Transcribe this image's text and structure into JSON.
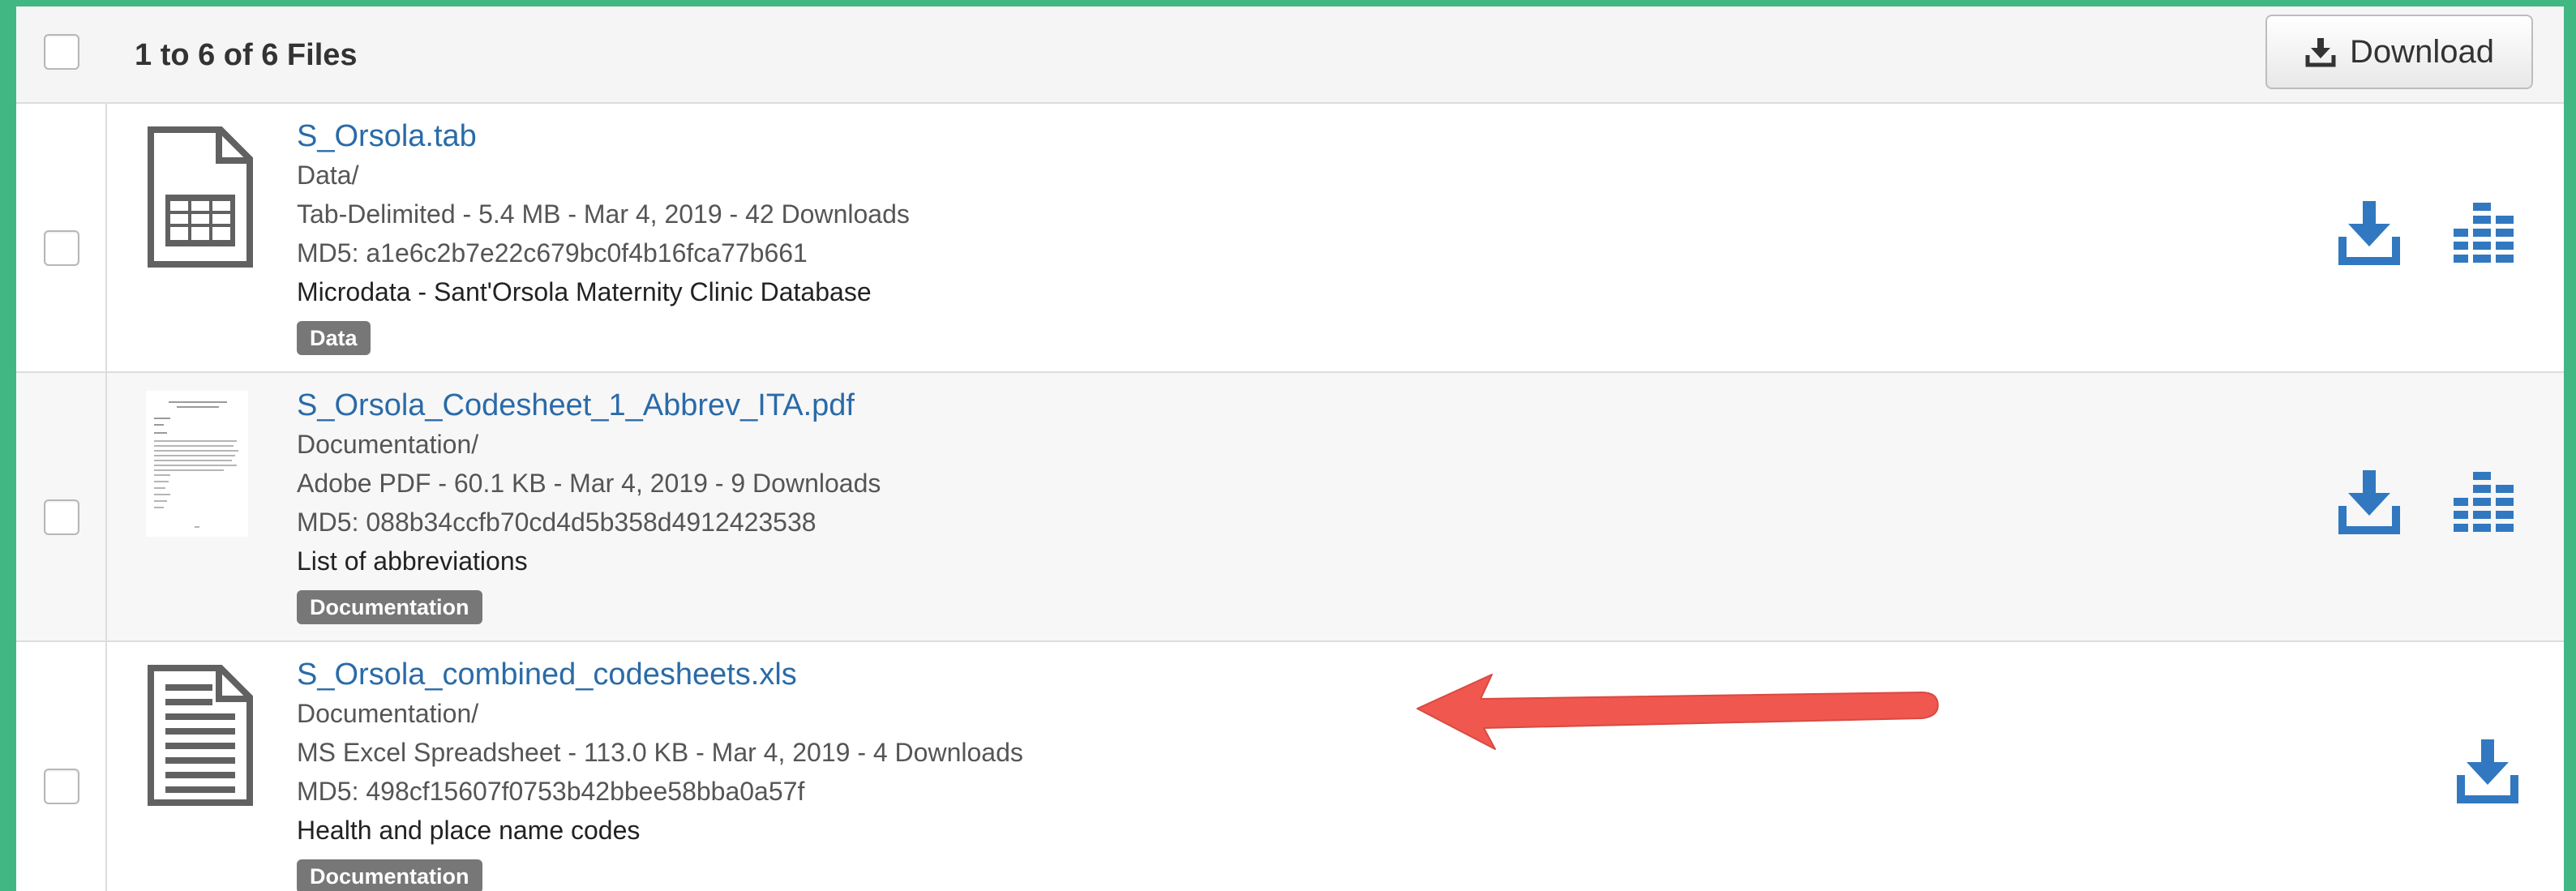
{
  "header": {
    "title": "1 to 6 of 6 Files",
    "download_label": "Download"
  },
  "files": [
    {
      "name": "S_Orsola.tab",
      "folder": "Data/",
      "details": "Tab-Delimited - 5.4 MB - Mar 4, 2019 - 42 Downloads",
      "md5": "MD5: a1e6c2b7e22c679bc0f4b16fca77b661",
      "description": "Microdata - Sant'Orsola Maternity Clinic Database",
      "tag": "Data",
      "thumbnail_icon": "tabular-file-icon",
      "actions": [
        "download-icon",
        "explore-icon"
      ]
    },
    {
      "name": "S_Orsola_Codesheet_1_Abbrev_ITA.pdf",
      "folder": "Documentation/",
      "details": "Adobe PDF - 60.1 KB - Mar 4, 2019 - 9 Downloads",
      "md5": "MD5: 088b34ccfb70cd4d5b358d4912423538",
      "description": "List of abbreviations",
      "tag": "Documentation",
      "thumbnail_icon": "pdf-thumbnail",
      "actions": [
        "download-icon",
        "explore-icon"
      ]
    },
    {
      "name": "S_Orsola_combined_codesheets.xls",
      "folder": "Documentation/",
      "details": "MS Excel Spreadsheet - 113.0 KB - Mar 4, 2019 - 4 Downloads",
      "md5": "MD5: 498cf15607f0753b42bbee58bba0a57f",
      "description": "Health and place name codes",
      "tag": "Documentation",
      "thumbnail_icon": "document-file-icon",
      "actions": [
        "download-icon"
      ]
    }
  ],
  "colors": {
    "frame_border": "#41b883",
    "link": "#2a6ba8",
    "action_icon": "#3178c0",
    "tag_bg": "#777777",
    "annotation_arrow": "#f0574e"
  }
}
